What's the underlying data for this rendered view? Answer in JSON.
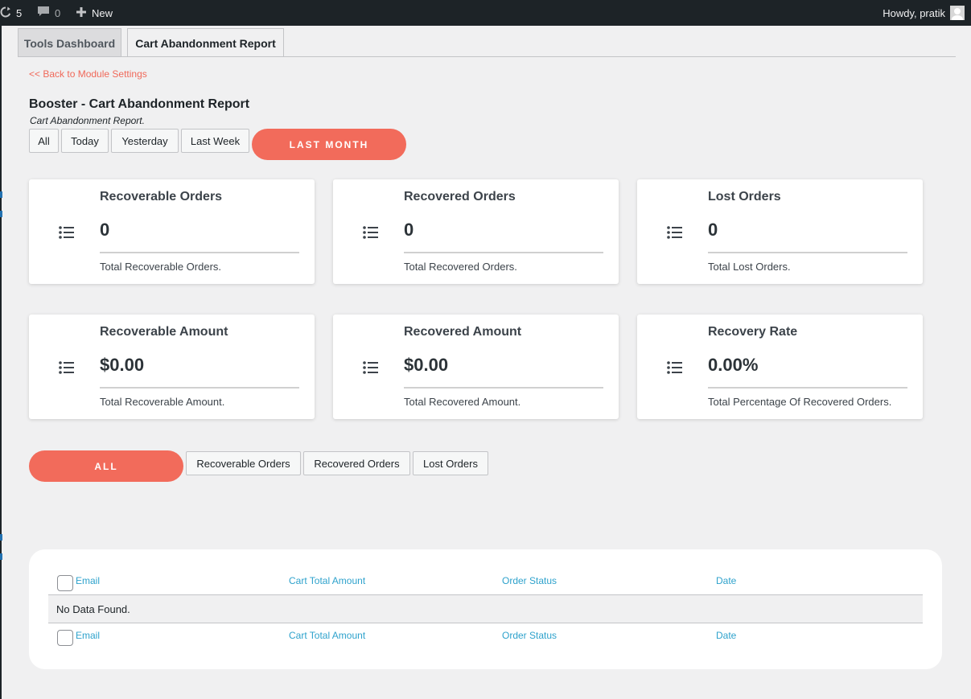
{
  "adminbar": {
    "updates_count": "5",
    "comments_count": "0",
    "new_label": "New",
    "howdy": "Howdy, pratik"
  },
  "tabs": [
    {
      "label": "Tools Dashboard",
      "active": false
    },
    {
      "label": "Cart Abandonment Report",
      "active": true
    }
  ],
  "back_link": "<< Back to Module Settings",
  "page": {
    "title": "Booster - Cart Abandonment Report",
    "subtitle": "Cart Abandonment Report."
  },
  "date_filters": {
    "all": "All",
    "today": "Today",
    "yesterday": "Yesterday",
    "last_week": "Last Week",
    "last_month": "LAST MONTH",
    "active": "last_month"
  },
  "cards": [
    {
      "title": "Recoverable Orders",
      "value": "0",
      "desc": "Total Recoverable Orders."
    },
    {
      "title": "Recovered Orders",
      "value": "0",
      "desc": "Total Recovered Orders."
    },
    {
      "title": "Lost Orders",
      "value": "0",
      "desc": "Total Lost Orders."
    },
    {
      "title": "Recoverable Amount",
      "value": "$0.00",
      "desc": "Total Recoverable Amount."
    },
    {
      "title": "Recovered Amount",
      "value": "$0.00",
      "desc": "Total Recovered Amount."
    },
    {
      "title": "Recovery Rate",
      "value": "0.00%",
      "desc": "Total Percentage Of Recovered Orders."
    }
  ],
  "status_filters": {
    "all": "ALL",
    "recoverable": "Recoverable Orders",
    "recovered": "Recovered Orders",
    "lost": "Lost Orders",
    "active": "all"
  },
  "table": {
    "columns": [
      "Email",
      "Cart Total Amount",
      "Order Status",
      "Date"
    ],
    "empty_message": "No Data Found."
  },
  "colors": {
    "accent": "#f26b5b",
    "link": "#2ea2cc",
    "adminbar": "#1d2327"
  }
}
